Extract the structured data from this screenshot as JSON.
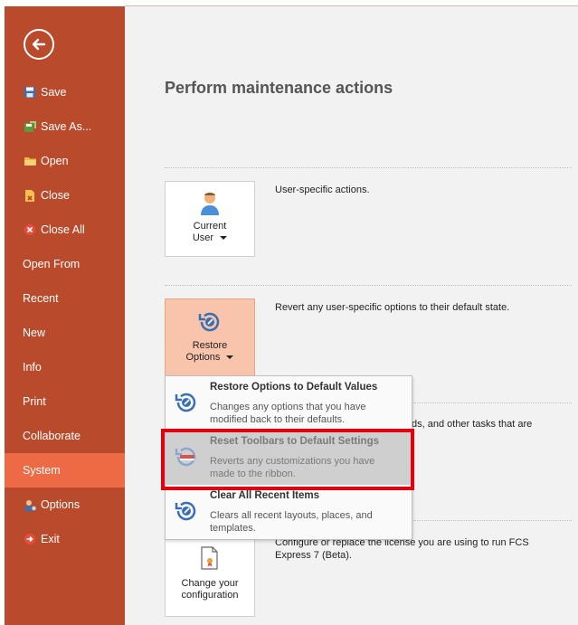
{
  "sidebar": {
    "back_icon": "back-arrow-icon",
    "items": [
      {
        "label": "Save",
        "icon": "save-icon"
      },
      {
        "label": "Save As...",
        "icon": "save-as-icon"
      },
      {
        "label": "Open",
        "icon": "open-folder-icon"
      },
      {
        "label": "Close",
        "icon": "close-file-icon"
      },
      {
        "label": "Close All",
        "icon": "close-all-icon"
      },
      {
        "label": "Open From",
        "icon": ""
      },
      {
        "label": "Recent",
        "icon": ""
      },
      {
        "label": "New",
        "icon": ""
      },
      {
        "label": "Info",
        "icon": ""
      },
      {
        "label": "Print",
        "icon": ""
      },
      {
        "label": "Collaborate",
        "icon": ""
      },
      {
        "label": "System",
        "icon": "",
        "selected": true
      },
      {
        "label": "Options",
        "icon": "options-icon"
      },
      {
        "label": "Exit",
        "icon": "exit-icon"
      }
    ]
  },
  "main": {
    "title": "Perform maintenance actions",
    "sections": [
      {
        "button_label_1": "Current",
        "button_label_2": "User",
        "description": "User-specific actions."
      },
      {
        "button_label_1": "Restore",
        "button_label_2": "Options",
        "description": "Revert any user-specific options to their default state."
      },
      {
        "partial_description": "ds, and other tasks that are"
      },
      {
        "button_label_1": "Change your",
        "button_label_2": "configuration",
        "description_line1": "Configure or replace the license you are using to run FCS",
        "description_line2": "Express 7 (Beta)."
      }
    ]
  },
  "menu": {
    "items": [
      {
        "title": "Restore Options to Default Values",
        "desc": "Changes any options that you have modified back to their defaults."
      },
      {
        "title": "Reset Toolbars to Default Settings",
        "desc": "Reverts any customizations you have made to the ribbon."
      },
      {
        "title": "Clear All Recent Items",
        "desc": "Clears all recent layouts, places, and templates."
      }
    ]
  },
  "colors": {
    "sidebar": "#b94b2c",
    "selected": "#ee6a44",
    "highlight": "#e3000f",
    "active_button": "#f8c4ac"
  }
}
